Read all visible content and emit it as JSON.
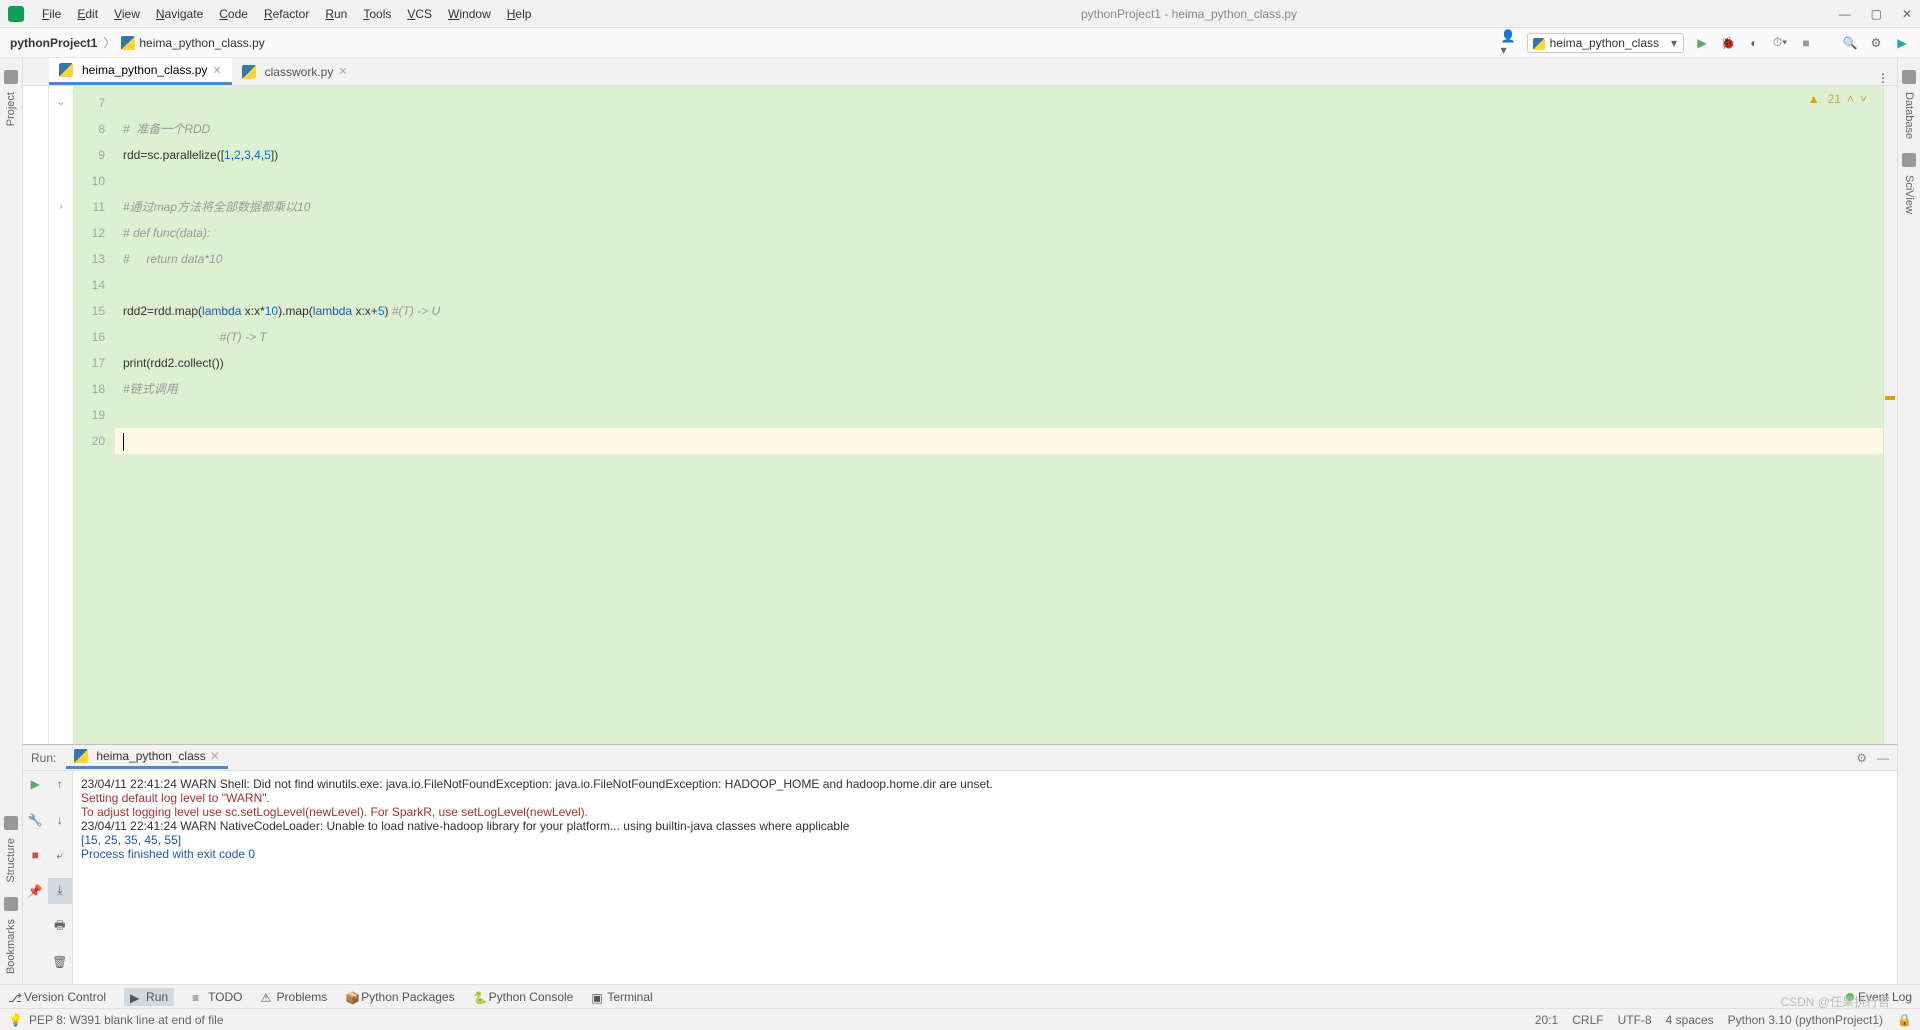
{
  "window": {
    "title": "pythonProject1 - heima_python_class.py"
  },
  "menus": [
    "File",
    "Edit",
    "View",
    "Navigate",
    "Code",
    "Refactor",
    "Run",
    "Tools",
    "VCS",
    "Window",
    "Help"
  ],
  "breadcrumb": {
    "project": "pythonProject1",
    "file": "heima_python_class.py"
  },
  "run_config": "heima_python_class",
  "tabs": [
    {
      "name": "heima_python_class.py",
      "active": true
    },
    {
      "name": "classwork.py",
      "active": false
    }
  ],
  "inspection": {
    "warn_count": "21"
  },
  "code_lines": [
    {
      "n": 7,
      "t": ""
    },
    {
      "n": 8,
      "t": "#  准备一个RDD",
      "cls": "c-comment"
    },
    {
      "n": 9,
      "t": "rdd=sc.parallelize([1,2,3,4,5])"
    },
    {
      "n": 10,
      "t": ""
    },
    {
      "n": 11,
      "t": "#通过map方法将全部数据都乘以10",
      "cls": "c-comment"
    },
    {
      "n": 12,
      "t": "# def func(data):",
      "cls": "c-comment"
    },
    {
      "n": 13,
      "t": "#     return data*10",
      "cls": "c-comment"
    },
    {
      "n": 14,
      "t": ""
    },
    {
      "n": 15,
      "t": "rdd2=rdd.map(lambda x:x*10).map(lambda x:x+5) #(T) -> U"
    },
    {
      "n": 16,
      "t": "                             #(T) -> T",
      "cls": "c-comment"
    },
    {
      "n": 17,
      "t": "print(rdd2.collect())"
    },
    {
      "n": 18,
      "t": "#链式调用",
      "cls": "c-comment"
    },
    {
      "n": 19,
      "t": ""
    },
    {
      "n": 20,
      "t": "",
      "current": true
    }
  ],
  "run_tab_name": "heima_python_class",
  "run_label": "Run:",
  "console": [
    {
      "cls": "dark",
      "t": "23/04/11 22:41:24 WARN Shell: Did not find winutils.exe: java.io.FileNotFoundException: java.io.FileNotFoundException: HADOOP_HOME and hadoop.home.dir are unset."
    },
    {
      "cls": "red",
      "t": "Setting default log level to \"WARN\"."
    },
    {
      "cls": "red",
      "t": "To adjust logging level use sc.setLogLevel(newLevel). For SparkR, use setLogLevel(newLevel)."
    },
    {
      "cls": "dark",
      "t": "23/04/11 22:41:24 WARN NativeCodeLoader: Unable to load native-hadoop library for your platform... using builtin-java classes where applicable"
    },
    {
      "cls": "blue",
      "t": "[15, 25, 35, 45, 55]"
    },
    {
      "cls": "dark",
      "t": ""
    },
    {
      "cls": "blue",
      "t": "Process finished with exit code 0"
    }
  ],
  "bottom_tools": [
    "Version Control",
    "Run",
    "TODO",
    "Problems",
    "Python Packages",
    "Python Console",
    "Terminal"
  ],
  "event_log": "Event Log",
  "status": {
    "left": "PEP 8: W391 blank line at end of file",
    "pos": "20:1",
    "eol": "CRLF",
    "enc": "UTF-8",
    "indent": "4 spaces",
    "interp": "Python 3.10 (pythonProject1)"
  },
  "left_tools": [
    "Project",
    "Structure",
    "Bookmarks"
  ],
  "right_tools": [
    "Database",
    "SciView"
  ],
  "watermark": "CSDN @任果执行官"
}
